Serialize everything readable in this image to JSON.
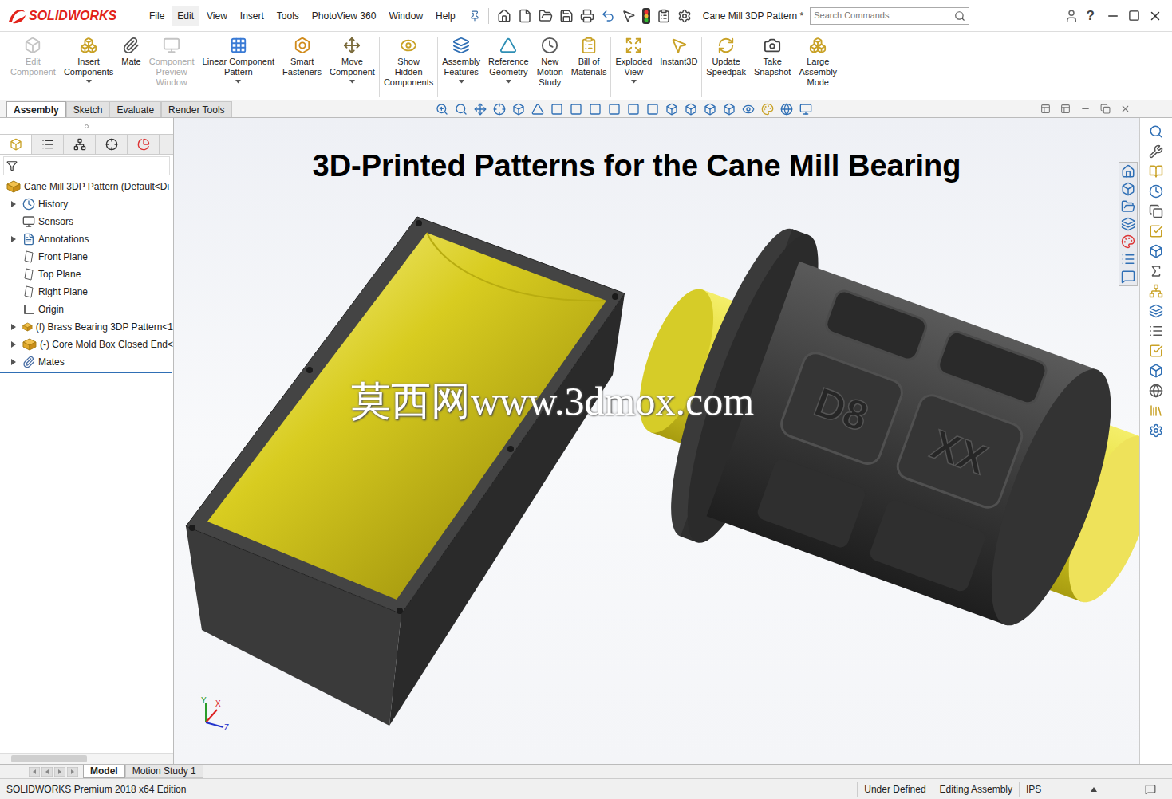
{
  "app": {
    "logo": "SOLIDWORKS"
  },
  "menu": [
    {
      "label": "File",
      "selected": false
    },
    {
      "label": "Edit",
      "selected": true
    },
    {
      "label": "View",
      "selected": false
    },
    {
      "label": "Insert",
      "selected": false
    },
    {
      "label": "Tools",
      "selected": false
    },
    {
      "label": "PhotoView 360",
      "selected": false
    },
    {
      "label": "Window",
      "selected": false
    },
    {
      "label": "Help",
      "selected": false
    }
  ],
  "document_title": "Cane Mill 3DP Pattern *",
  "search": {
    "placeholder": "Search Commands"
  },
  "help_glyph": "?",
  "ribbon": [
    [
      {
        "lines": [
          "Edit",
          "Component"
        ],
        "disabled": true,
        "dropdown": false
      },
      {
        "lines": [
          "Insert",
          "Components"
        ],
        "disabled": false,
        "dropdown": true
      },
      {
        "lines": [
          "Mate"
        ],
        "disabled": false,
        "dropdown": false
      },
      {
        "lines": [
          "Component",
          "Preview",
          "Window"
        ],
        "disabled": true,
        "dropdown": false
      },
      {
        "lines": [
          "Linear Component",
          "Pattern"
        ],
        "disabled": false,
        "dropdown": true
      },
      {
        "lines": [
          "Smart",
          "Fasteners"
        ],
        "disabled": false,
        "dropdown": false
      },
      {
        "lines": [
          "Move",
          "Component"
        ],
        "disabled": false,
        "dropdown": true
      }
    ],
    [
      {
        "lines": [
          "Show",
          "Hidden",
          "Components"
        ],
        "disabled": false,
        "dropdown": false
      }
    ],
    [
      {
        "lines": [
          "Assembly",
          "Features"
        ],
        "disabled": false,
        "dropdown": true
      },
      {
        "lines": [
          "Reference",
          "Geometry"
        ],
        "disabled": false,
        "dropdown": true
      },
      {
        "lines": [
          "New",
          "Motion",
          "Study"
        ],
        "disabled": false,
        "dropdown": false
      },
      {
        "lines": [
          "Bill of",
          "Materials"
        ],
        "disabled": false,
        "dropdown": false
      }
    ],
    [
      {
        "lines": [
          "Exploded",
          "View"
        ],
        "disabled": false,
        "dropdown": true
      },
      {
        "lines": [
          "Instant3D"
        ],
        "disabled": false,
        "dropdown": false
      }
    ],
    [
      {
        "lines": [
          "Update",
          "Speedpak"
        ],
        "disabled": false,
        "dropdown": false
      },
      {
        "lines": [
          "Take",
          "Snapshot"
        ],
        "disabled": false,
        "dropdown": false
      },
      {
        "lines": [
          "Large",
          "Assembly",
          "Mode"
        ],
        "disabled": false,
        "dropdown": false
      }
    ]
  ],
  "command_tabs": [
    {
      "label": "Assembly",
      "selected": true
    },
    {
      "label": "Sketch",
      "selected": false
    },
    {
      "label": "Evaluate",
      "selected": false
    },
    {
      "label": "Render Tools",
      "selected": false
    }
  ],
  "tree": {
    "root": "Cane Mill 3DP Pattern  (Default<Di",
    "items": [
      {
        "label": "History",
        "kind": "history",
        "expandable": true
      },
      {
        "label": "Sensors",
        "kind": "sensors",
        "expandable": false
      },
      {
        "label": "Annotations",
        "kind": "annotations",
        "expandable": true
      },
      {
        "label": "Front Plane",
        "kind": "plane",
        "expandable": false
      },
      {
        "label": "Top Plane",
        "kind": "plane",
        "expandable": false
      },
      {
        "label": "Right Plane",
        "kind": "plane",
        "expandable": false
      },
      {
        "label": "Origin",
        "kind": "origin",
        "expandable": false
      },
      {
        "label": "(f) Brass Bearing 3DP Pattern<1",
        "kind": "component",
        "expandable": true
      },
      {
        "label": "(-) Core Mold Box Closed End<",
        "kind": "component",
        "expandable": true
      },
      {
        "label": "Mates",
        "kind": "mates",
        "expandable": true
      }
    ]
  },
  "viewport": {
    "title": "3D-Printed Patterns for the Cane Mill Bearing",
    "watermark": "莫西网www.3dmox.com",
    "engravings": [
      "D8",
      "XX"
    ],
    "triad": [
      "Y",
      "X",
      "Z"
    ]
  },
  "bottom_tabs": [
    {
      "label": "Model",
      "selected": true
    },
    {
      "label": "Motion Study 1",
      "selected": false
    }
  ],
  "status_bar": {
    "edition": "SOLIDWORKS Premium 2018 x64 Edition",
    "items": [
      "Under Defined",
      "Editing Assembly",
      "IPS"
    ]
  }
}
